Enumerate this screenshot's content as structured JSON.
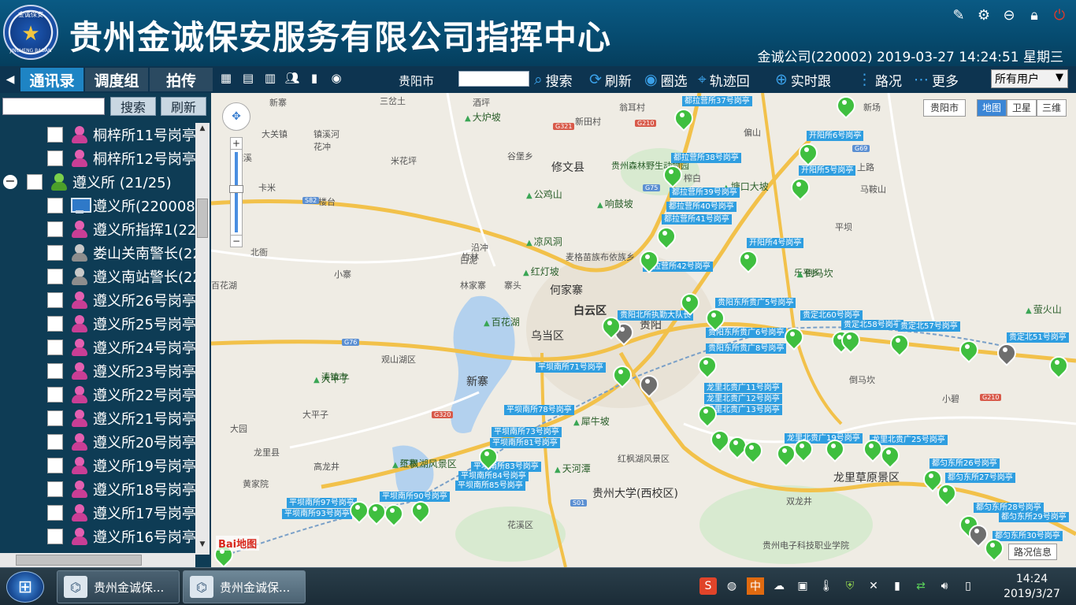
{
  "header": {
    "logo_top_text": "金诚保安",
    "logo_bottom_text": "JINCHENG BAOAN",
    "title": "贵州金诚保安服务有限公司指挥中心",
    "info": "金诚公司(220002)  2019-03-27 14:24:51  星期三",
    "icons": [
      "broom-icon",
      "gear-icon",
      "minimize-icon",
      "lock-icon",
      "power-icon"
    ]
  },
  "left_tabs": {
    "arrow": "◀",
    "tabs": [
      "通讯录",
      "调度组",
      "拍传"
    ]
  },
  "toolbar": {
    "city": "贵阳市",
    "search": "搜索",
    "refresh": "刷新",
    "circle_select": "圈选",
    "track": "轨迹回",
    "realtime": "实时跟",
    "traffic": "路况",
    "more": "更多",
    "user_filter": "所有用户"
  },
  "left_panel": {
    "search_btn": "搜索",
    "refresh_btn": "刷新",
    "rows": [
      {
        "label": "桐梓所11号岗亭",
        "icon": "pink"
      },
      {
        "label": "桐梓所12号岗亭",
        "icon": "pink"
      },
      {
        "label": "遵义所    (21/25)",
        "icon": "green"
      },
      {
        "label": "遵义所(220008)",
        "icon": "monitor"
      },
      {
        "label": "遵义所指挥1(22",
        "icon": "pink"
      },
      {
        "label": "娄山关南警长(22",
        "icon": "gray"
      },
      {
        "label": "遵义南站警长(22",
        "icon": "gray"
      },
      {
        "label": "遵义所26号岗亭",
        "icon": "pink"
      },
      {
        "label": "遵义所25号岗亭",
        "icon": "pink"
      },
      {
        "label": "遵义所24号岗亭",
        "icon": "pink"
      },
      {
        "label": "遵义所23号岗亭",
        "icon": "pink"
      },
      {
        "label": "遵义所22号岗亭",
        "icon": "pink"
      },
      {
        "label": "遵义所21号岗亭",
        "icon": "pink"
      },
      {
        "label": "遵义所20号岗亭",
        "icon": "pink"
      },
      {
        "label": "遵义所19号岗亭",
        "icon": "pink"
      },
      {
        "label": "遵义所18号岗亭",
        "icon": "pink"
      },
      {
        "label": "遵义所17号岗亭",
        "icon": "pink"
      },
      {
        "label": "遵义所16号岗亭",
        "icon": "pink"
      }
    ]
  },
  "map": {
    "city_chip": "贵阳市",
    "map_types": [
      "地图",
      "卫星",
      "三维"
    ],
    "baidu": "Bai地图",
    "traffic_info": "路况信息",
    "places": [
      "新寨",
      "三岔土",
      "酒坪",
      "新田村",
      "翁耳村",
      "新场",
      "偏山",
      "大关镇",
      "镇溪河",
      "花冲",
      "米花坪",
      "谷堡乡",
      "修文县",
      "贵州森林野生动物园",
      "德溪",
      "榨白",
      "楼台",
      "卡米",
      "马鞍山",
      "上路",
      "平坝",
      "北衙",
      "竹林",
      "白泥",
      "麦格苗族布依族乡",
      "沿冲",
      "小寨",
      "林家寨",
      "寨头",
      "百花湖",
      "何家寨",
      "白云区",
      "贵阳",
      "乌当区",
      "观山湖区",
      "新寨",
      "清镇市",
      "大平子",
      "下寨",
      "红枫湖风景区",
      "贵州大学(西校区)",
      "花溪区",
      "贵州电子科技职业学院",
      "龙里草原景区",
      "龙里县",
      "大园",
      "黄家院",
      "乐平乡",
      "倒马坎",
      "高龙井",
      "小碧",
      "双龙井",
      "麻底"
    ],
    "pois": [
      "大炉坡",
      "公鸡山",
      "响鼓坡",
      "凉风洞",
      "红灯坡",
      "百花湖",
      "大平子",
      "天河潭",
      "犀牛坡",
      "红枫湖风景区",
      "塘口大坡",
      "倒马坎",
      "萤火山"
    ],
    "roads": [
      "G321",
      "G210",
      "G75",
      "S82",
      "G76",
      "G320",
      "G69",
      "S01",
      "G210"
    ],
    "labels": [
      "都拉营所37号岗亭",
      "都拉营所38号岗亭",
      "都拉营所39号岗亭",
      "都拉营所40号岗亭",
      "都拉营所41号岗亭",
      "都拉营所42号岗亭",
      "开阳所6号岗亭",
      "开阳所5号岗亭",
      "开阳所4号岗亭",
      "贵阳东所贵广8号岗亭",
      "贵阳东所贵广6号岗亭",
      "贵阳北所执勤大队长",
      "贵定北58号岗亭",
      "贵定北57号岗亭",
      "贵定北51号岗亭",
      "龙里北贵广11号岗亭",
      "龙里北贵广12号岗亭",
      "龙里北贵广13号岗亭",
      "龙里北贵广19号岗亭",
      "龙里北贵广25号岗亭",
      "都匀东所26号岗亭",
      "都匀东所27号岗亭",
      "都匀东所28号岗亭",
      "都匀东所29号岗亭",
      "都匀东所30号岗亭",
      "平坝南所71号岗亭",
      "平坝南所73号岗亭",
      "平坝南所78号岗亭",
      "平坝南所81号岗亭",
      "平坝南所83号岗亭",
      "平坝南所84号岗亭",
      "平坝南所85号岗亭",
      "平坝南所90号岗亭",
      "平坝南所93号岗亭",
      "平坝南所97号岗亭",
      "贵定北60号岗亭",
      "贵阳东所贵广5号岗亭"
    ]
  },
  "taskbar": {
    "tasks": [
      "贵州金诚保...",
      "贵州金诚保..."
    ],
    "time": "14:24",
    "date": "2019/3/27"
  }
}
